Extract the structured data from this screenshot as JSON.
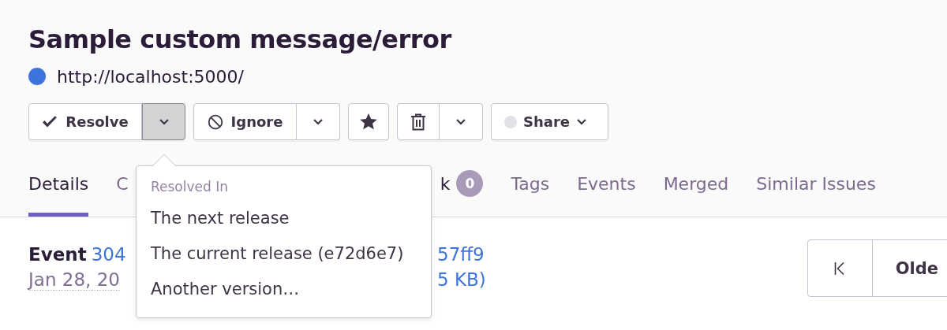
{
  "issue": {
    "title": "Sample custom message/error",
    "project": {
      "url": "http://localhost:5000/",
      "color": "#3d74db"
    }
  },
  "actions": [
    {
      "kind": "resolve",
      "label": "Resolve",
      "expanded": true
    },
    {
      "kind": "ignore",
      "label": "Ignore",
      "expanded": false
    },
    {
      "kind": "bookmark"
    },
    {
      "kind": "delete",
      "expanded": false
    },
    {
      "kind": "share",
      "label": "Share"
    }
  ],
  "resolve_menu": {
    "header": "Resolved In",
    "items": [
      "The next release",
      "The current release (e72d6e7)",
      "Another version…"
    ]
  },
  "tabs": [
    {
      "label": "Details",
      "selected": true
    },
    {
      "label": "C",
      "selected": false
    },
    {
      "label": "k",
      "selected": false,
      "badge": "0"
    },
    {
      "label": "Tags",
      "selected": false
    },
    {
      "label": "Events",
      "selected": false
    },
    {
      "label": "Merged",
      "selected": false
    },
    {
      "label": "Similar Issues",
      "selected": false
    }
  ],
  "event": {
    "label": "Event",
    "id": "304",
    "hash": "57ff9",
    "date": "Jan 28, 20",
    "size": "5 KB)"
  },
  "pagination": [
    {
      "kind": "oldest"
    },
    {
      "kind": "older",
      "label": "Olde"
    }
  ]
}
